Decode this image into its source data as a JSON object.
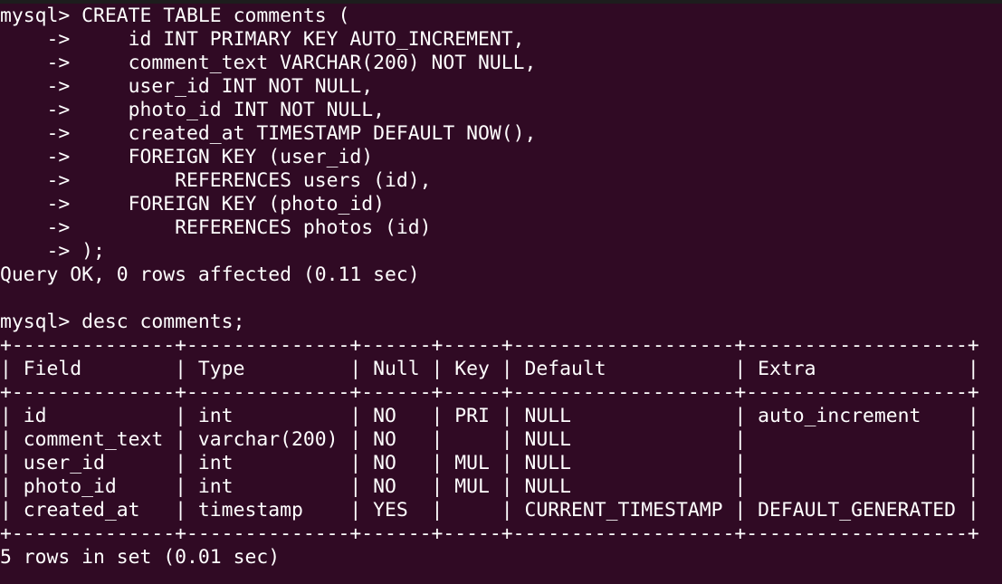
{
  "terminal": {
    "lines": [
      "mysql> CREATE TABLE comments (",
      "    ->     id INT PRIMARY KEY AUTO_INCREMENT,",
      "    ->     comment_text VARCHAR(200) NOT NULL,",
      "    ->     user_id INT NOT NULL,",
      "    ->     photo_id INT NOT NULL,",
      "    ->     created_at TIMESTAMP DEFAULT NOW(),",
      "    ->     FOREIGN KEY (user_id)",
      "    ->         REFERENCES users (id),",
      "    ->     FOREIGN KEY (photo_id)",
      "    ->         REFERENCES photos (id)",
      "    -> );",
      "Query OK, 0 rows affected (0.11 sec)",
      "",
      "mysql> desc comments;",
      "+--------------+--------------+------+-----+-------------------+-------------------+",
      "| Field        | Type         | Null | Key | Default           | Extra             |",
      "+--------------+--------------+------+-----+-------------------+-------------------+",
      "| id           | int          | NO   | PRI | NULL              | auto_increment    |",
      "| comment_text | varchar(200) | NO   |     | NULL              |                   |",
      "| user_id      | int          | NO   | MUL | NULL              |                   |",
      "| photo_id     | int          | NO   | MUL | NULL              |                   |",
      "| created_at   | timestamp    | YES  |     | CURRENT_TIMESTAMP | DEFAULT_GENERATED |",
      "+--------------+--------------+------+-----+-------------------+-------------------+",
      "5 rows in set (0.01 sec)"
    ]
  }
}
